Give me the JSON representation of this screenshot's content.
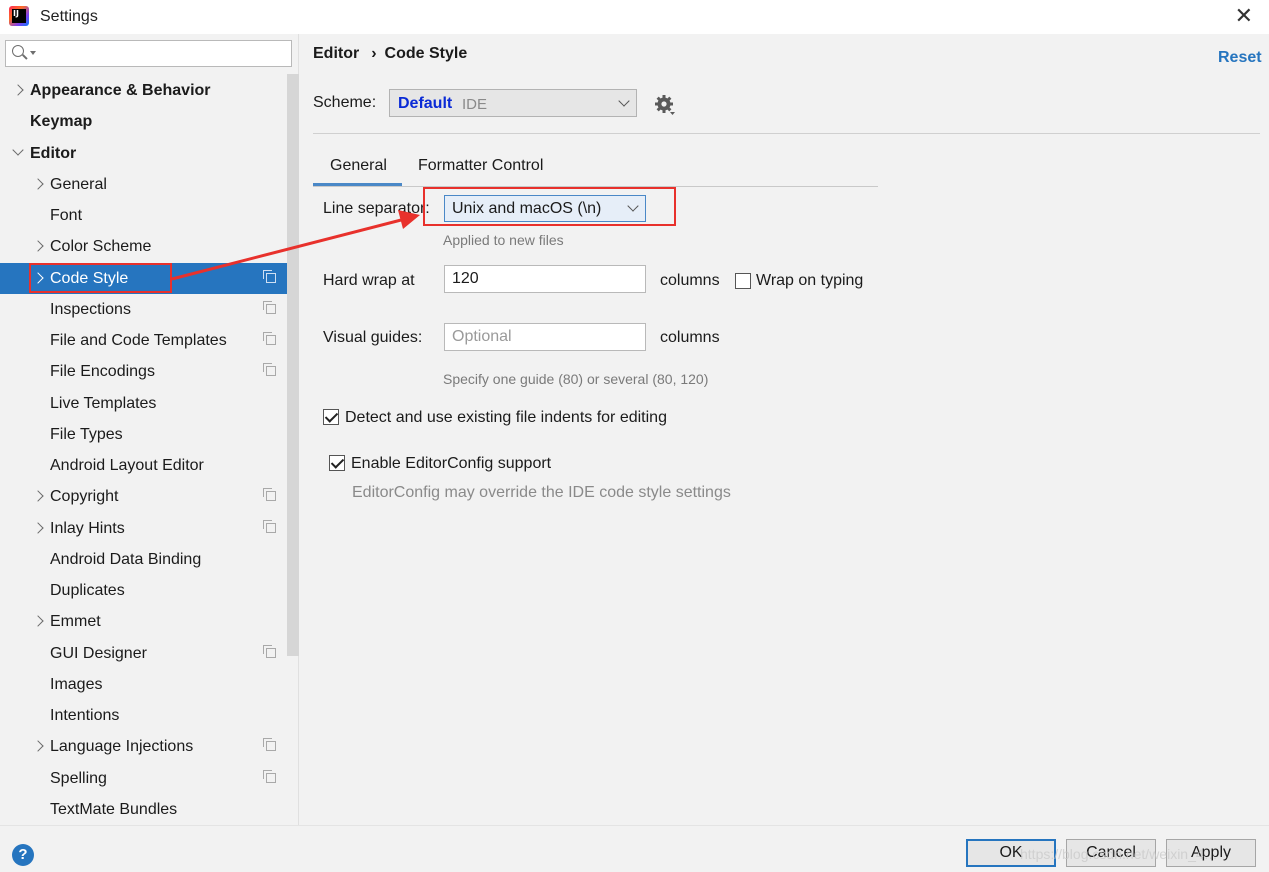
{
  "window": {
    "title": "Settings",
    "close": "✕"
  },
  "search": {
    "placeholder": ""
  },
  "sidebar": {
    "items": [
      {
        "label": "Appearance & Behavior",
        "indent": 0,
        "arrow": "right",
        "bold": true,
        "copy": false
      },
      {
        "label": "Keymap",
        "indent": 0,
        "arrow": "none",
        "bold": true,
        "copy": false
      },
      {
        "label": "Editor",
        "indent": 0,
        "arrow": "down",
        "bold": true,
        "copy": false
      },
      {
        "label": "General",
        "indent": 1,
        "arrow": "right",
        "bold": false,
        "copy": false
      },
      {
        "label": "Font",
        "indent": 1,
        "arrow": "none",
        "bold": false,
        "copy": false
      },
      {
        "label": "Color Scheme",
        "indent": 1,
        "arrow": "right",
        "bold": false,
        "copy": false
      },
      {
        "label": "Code Style",
        "indent": 1,
        "arrow": "right",
        "bold": false,
        "copy": true,
        "selected": true
      },
      {
        "label": "Inspections",
        "indent": 1,
        "arrow": "none",
        "bold": false,
        "copy": true
      },
      {
        "label": "File and Code Templates",
        "indent": 1,
        "arrow": "none",
        "bold": false,
        "copy": true
      },
      {
        "label": "File Encodings",
        "indent": 1,
        "arrow": "none",
        "bold": false,
        "copy": true
      },
      {
        "label": "Live Templates",
        "indent": 1,
        "arrow": "none",
        "bold": false,
        "copy": false
      },
      {
        "label": "File Types",
        "indent": 1,
        "arrow": "none",
        "bold": false,
        "copy": false
      },
      {
        "label": "Android Layout Editor",
        "indent": 1,
        "arrow": "none",
        "bold": false,
        "copy": false
      },
      {
        "label": "Copyright",
        "indent": 1,
        "arrow": "right",
        "bold": false,
        "copy": true
      },
      {
        "label": "Inlay Hints",
        "indent": 1,
        "arrow": "right",
        "bold": false,
        "copy": true
      },
      {
        "label": "Android Data Binding",
        "indent": 1,
        "arrow": "none",
        "bold": false,
        "copy": false
      },
      {
        "label": "Duplicates",
        "indent": 1,
        "arrow": "none",
        "bold": false,
        "copy": false
      },
      {
        "label": "Emmet",
        "indent": 1,
        "arrow": "right",
        "bold": false,
        "copy": false
      },
      {
        "label": "GUI Designer",
        "indent": 1,
        "arrow": "none",
        "bold": false,
        "copy": true
      },
      {
        "label": "Images",
        "indent": 1,
        "arrow": "none",
        "bold": false,
        "copy": false
      },
      {
        "label": "Intentions",
        "indent": 1,
        "arrow": "none",
        "bold": false,
        "copy": false
      },
      {
        "label": "Language Injections",
        "indent": 1,
        "arrow": "right",
        "bold": false,
        "copy": true
      },
      {
        "label": "Spelling",
        "indent": 1,
        "arrow": "none",
        "bold": false,
        "copy": true
      },
      {
        "label": "TextMate Bundles",
        "indent": 1,
        "arrow": "none",
        "bold": false,
        "copy": false
      }
    ]
  },
  "breadcrumb": {
    "parent": "Editor",
    "separator": "›",
    "current": "Code Style"
  },
  "reset_label": "Reset",
  "scheme": {
    "label": "Scheme:",
    "value": "Default",
    "suffix": "IDE"
  },
  "tabs": [
    {
      "label": "General",
      "active": true
    },
    {
      "label": "Formatter Control",
      "active": false
    }
  ],
  "general": {
    "line_separator_label": "Line separator:",
    "line_separator_value": "Unix and macOS (\\n)",
    "line_separator_hint": "Applied to new files",
    "hard_wrap_label": "Hard wrap at",
    "hard_wrap_value": "120",
    "hard_wrap_units": "columns",
    "wrap_on_typing_label": "Wrap on typing",
    "wrap_on_typing_checked": false,
    "visual_guides_label": "Visual guides:",
    "visual_guides_placeholder": "Optional",
    "visual_guides_units": "columns",
    "visual_guides_hint": "Specify one guide (80) or several (80, 120)",
    "detect_indents_label": "Detect and use existing file indents for editing",
    "detect_indents_checked": true,
    "editorconfig_label": "Enable EditorConfig support",
    "editorconfig_checked": true,
    "editorconfig_hint": "EditorConfig may override the IDE code style settings"
  },
  "buttons": {
    "help": "?",
    "ok": "OK",
    "cancel": "Cancel",
    "apply": "Apply"
  },
  "watermark": "https://blog.csdn.net/weixin_4…",
  "colors": {
    "accent": "#2675bf",
    "highlight": "#e8312c",
    "scheme_value": "#0a2ad6"
  }
}
